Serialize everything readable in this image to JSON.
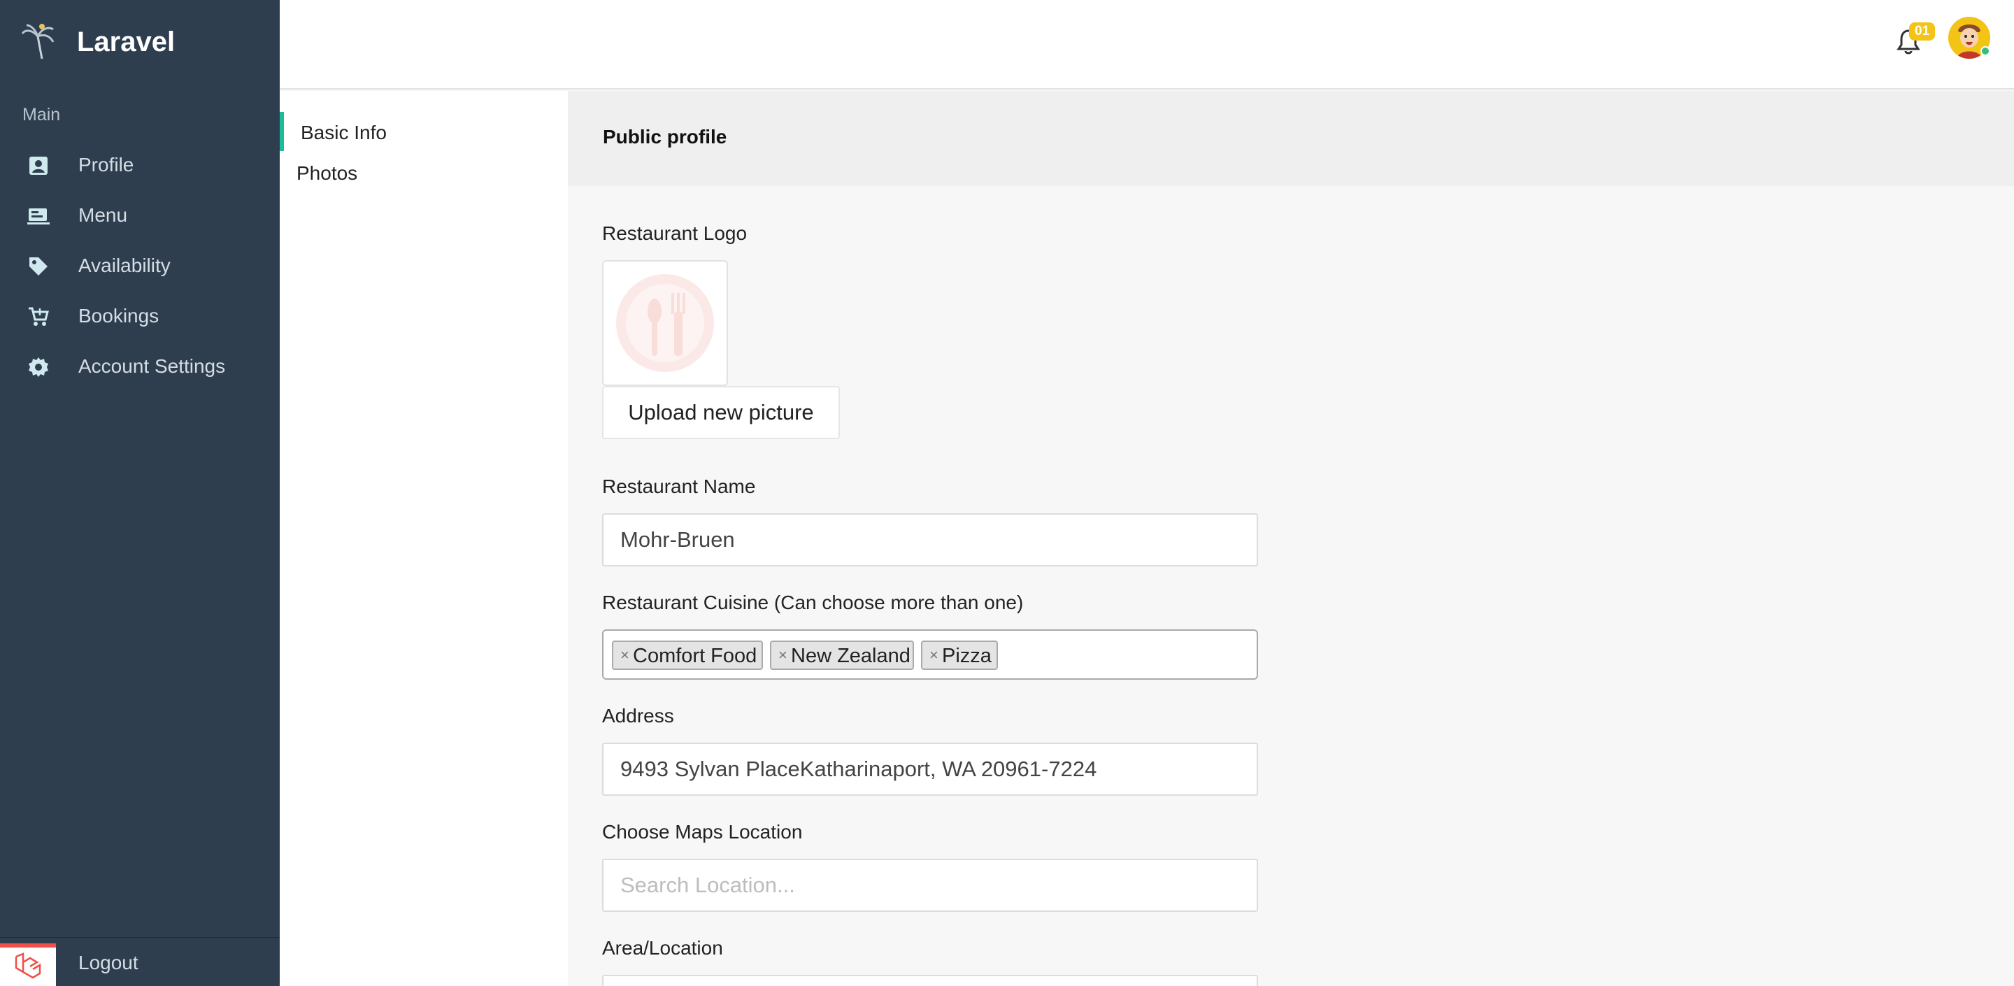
{
  "app": {
    "name": "Laravel"
  },
  "sidebar": {
    "section_label": "Main",
    "items": [
      {
        "label": "Profile",
        "icon": "profile-icon"
      },
      {
        "label": "Menu",
        "icon": "menu-icon"
      },
      {
        "label": "Availability",
        "icon": "tag-icon"
      },
      {
        "label": "Bookings",
        "icon": "cart-icon"
      },
      {
        "label": "Account Settings",
        "icon": "gear-icon"
      }
    ],
    "logout_label": "Logout"
  },
  "header": {
    "notification_count": "01"
  },
  "subnav": {
    "items": [
      {
        "label": "Basic Info",
        "active": true
      },
      {
        "label": "Photos",
        "active": false
      }
    ]
  },
  "content": {
    "title": "Public profile",
    "logo_label": "Restaurant Logo",
    "upload_label": "Upload new picture",
    "name_label": "Restaurant Name",
    "name_value": "Mohr-Bruen",
    "cuisine_label": "Restaurant Cuisine (Can choose more than one)",
    "cuisines": [
      "Comfort Food",
      "New Zealand",
      "Pizza"
    ],
    "address_label": "Address",
    "address_value": "9493 Sylvan PlaceKatharinaport, WA 20961-7224",
    "maps_label": "Choose Maps Location",
    "maps_placeholder": "Search Location...",
    "area_label": "Area/Location"
  },
  "colors": {
    "sidebar": "#2e3e4e",
    "accent": "#1abc9c",
    "badge": "#f3c316"
  }
}
